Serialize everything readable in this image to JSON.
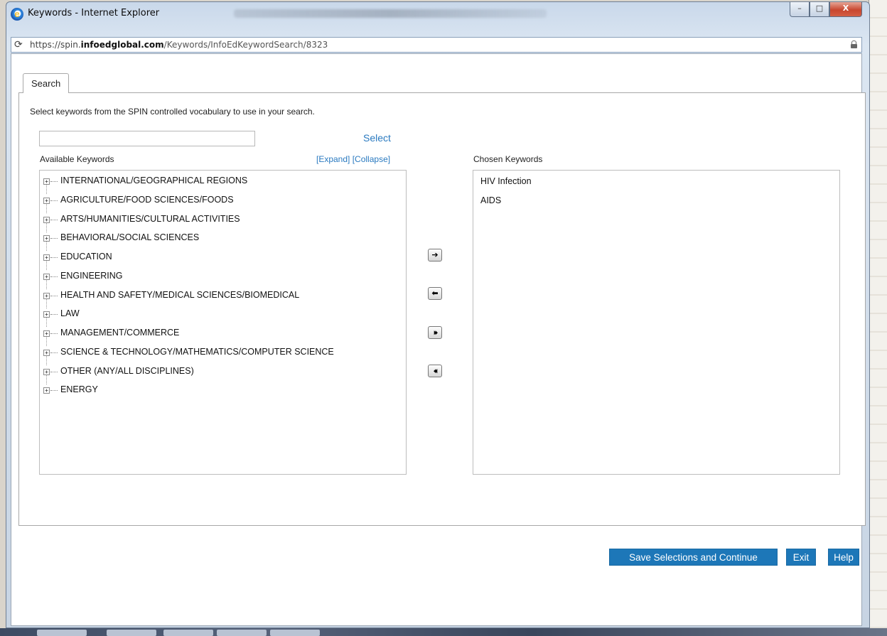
{
  "window": {
    "title": "Keywords - Internet Explorer",
    "url_host_prefix": "https://spin.",
    "url_host_domain": "infoedglobal.com",
    "url_path": "/Keywords/InfoEdKeywordSearch/8323",
    "caption_min": "–",
    "caption_max": "□",
    "caption_close": "X"
  },
  "tabs": [
    {
      "label": "Search",
      "active": true
    }
  ],
  "instructions": "Select keywords from the SPIN controlled vocabulary to use in your search.",
  "search": {
    "value": "",
    "select_link": "Select"
  },
  "available": {
    "label": "Available Keywords",
    "expand": "[Expand]",
    "collapse": "[Collapse]",
    "items": [
      "INTERNATIONAL/GEOGRAPHICAL REGIONS",
      "AGRICULTURE/FOOD SCIENCES/FOODS",
      "ARTS/HUMANITIES/CULTURAL ACTIVITIES",
      "BEHAVIORAL/SOCIAL SCIENCES",
      "EDUCATION",
      "ENGINEERING",
      "HEALTH AND SAFETY/MEDICAL SCIENCES/BIOMEDICAL",
      "LAW",
      "MANAGEMENT/COMMERCE",
      "SCIENCE & TECHNOLOGY/MATHEMATICS/COMPUTER SCIENCE",
      "OTHER (ANY/ALL DISCIPLINES)",
      "ENERGY"
    ]
  },
  "chosen": {
    "label": "Chosen Keywords",
    "items": [
      "HIV Infection",
      "AIDS"
    ]
  },
  "transfer_buttons": {
    "add": "➔",
    "remove": "⬅",
    "add_all": "⏵⏵",
    "remove_all": "⏴⏴"
  },
  "actions": {
    "save": "Save Selections and Continue",
    "exit": "Exit",
    "help": "Help"
  },
  "colors": {
    "link": "#2a7ac0",
    "button": "#1d77b8"
  }
}
